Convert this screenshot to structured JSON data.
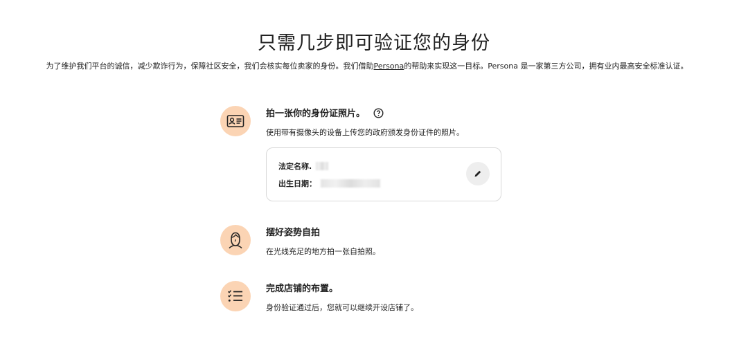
{
  "header": {
    "title": "只需几步即可验证您的身份",
    "intro_before": "为了维护我们平台的诚信，减少欺诈行为，保障社区安全，我们会核实每位卖家的身份。我们借助",
    "intro_link": "Persona",
    "intro_after": "的帮助来实现这一目标。Persona 是一家第三方公司，拥有业内最高安全标准认证。"
  },
  "steps": [
    {
      "title": "拍一张你的身份证照片。",
      "icon": "id-card-icon",
      "has_help": true,
      "help_icon": "help-circle-icon",
      "description": "使用带有摄像头的设备上传您的政府颁发身份证件的照片。"
    },
    {
      "title": "摆好姿势自拍",
      "icon": "selfie-face-icon",
      "description": "在光线充足的地方拍一张自拍照。"
    },
    {
      "title": "完成店铺的布置。",
      "icon": "checklist-icon",
      "description": "身份验证通过后，您就可以继续开设店铺了。"
    }
  ],
  "id_card": {
    "legal_name_label": "法定名称.",
    "dob_label": "出生日期：",
    "edit_icon": "pencil-icon"
  },
  "colors": {
    "icon_circle": "#fbd4b4",
    "text": "#222222",
    "card_border": "#d9d9d9",
    "edit_button_bg": "#eeeeee"
  }
}
